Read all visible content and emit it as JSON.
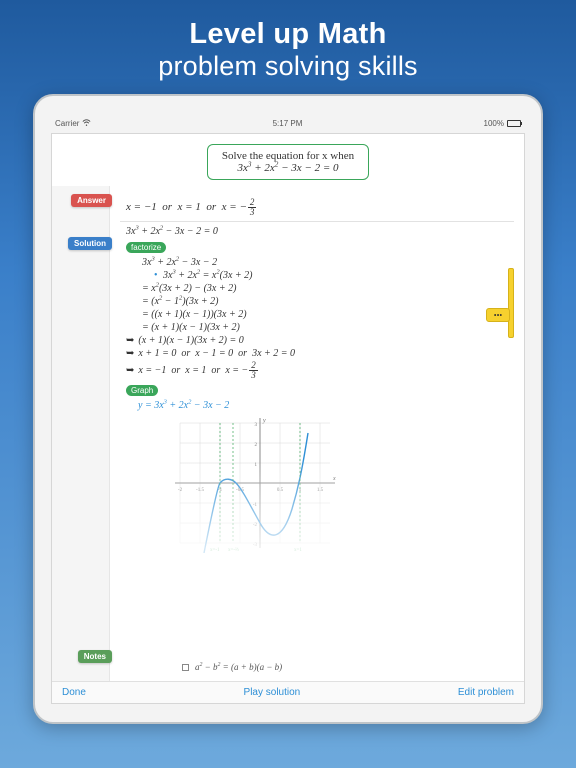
{
  "hero": {
    "title": "Level up Math",
    "subtitle": "problem solving skills"
  },
  "statusbar": {
    "carrier": "Carrier",
    "time": "5:17 PM",
    "battery": "100%"
  },
  "problem": {
    "prompt": "Solve the equation for x when",
    "equation_html": "3<i>x</i><sup>3</sup> + 2<i>x</i><sup>2</sup> − 3<i>x</i> − 2 = 0"
  },
  "badges": {
    "answer": "Answer",
    "solution": "Solution",
    "notes": "Notes"
  },
  "answer_html": "<i>x</i> = −1 &nbsp;or&nbsp; <i>x</i> = 1 &nbsp;or&nbsp; <i>x</i> = −<span class='frac'><span class='n'>2</span><span class='d'>3</span></span>",
  "solution": {
    "start_html": "3<i>x</i><sup>3</sup> + 2<i>x</i><sup>2</sup> − 3<i>x</i> − 2 = 0",
    "factor_label": "factorize",
    "steps_html": [
      "3<i>x</i><sup>3</sup> + 2<i>x</i><sup>2</sup> − 3<i>x</i> − 2",
      "<span class='dot'>•</span> 3<i>x</i><sup>3</sup> + 2<i>x</i><sup>2</sup> = <i>x</i><sup>2</sup>(3<i>x</i> + 2)",
      "= <i>x</i><sup>2</sup>(3<i>x</i> + 2) − (3<i>x</i> + 2)",
      "= (<i>x</i><sup>2</sup> − 1<sup>2</sup>)(3<i>x</i> + 2)",
      "= ((<i>x</i> + 1)(<i>x</i> − 1))(3<i>x</i> + 2)",
      "= (<i>x</i> + 1)(<i>x</i> − 1)(3<i>x</i> + 2)"
    ],
    "implications_html": [
      "(<i>x</i> + 1)(<i>x</i> − 1)(3<i>x</i> + 2) = 0",
      "<i>x</i> + 1 = 0 &nbsp;or&nbsp; <i>x</i> − 1 = 0 &nbsp;or&nbsp; 3<i>x</i> + 2 = 0",
      "<i>x</i> = −1 &nbsp;or&nbsp; <i>x</i> = 1 &nbsp;or&nbsp; <i>x</i> = −<span class='frac'><span class='n'>2</span><span class='d'>3</span></span>"
    ],
    "graph_label": "Graph",
    "graph_function_html": "<i>y</i> = 3<i>x</i><sup>3</sup> + 2<i>x</i><sup>2</sup> − 3<i>x</i> − 2"
  },
  "notes_identity_html": "<i>a</i><sup>2</sup> − <i>b</i><sup>2</sup> = (<i>a</i> + <i>b</i>)(<i>a</i> − <i>b</i>)",
  "toolbar": {
    "done": "Done",
    "play": "Play solution",
    "edit": "Edit problem"
  },
  "hint_dots": "•••",
  "chart_data": {
    "type": "line",
    "title": "",
    "xlabel": "x",
    "ylabel": "y",
    "xlim": [
      -2,
      2
    ],
    "ylim": [
      -3,
      3
    ],
    "xticks": [
      -2,
      -1.5,
      -1,
      -0.5,
      0.5,
      1,
      1.5,
      2
    ],
    "yticks": [
      -3,
      -2,
      -1,
      1,
      2,
      3
    ],
    "roots_annotations": [
      "x = -1",
      "x = -2/3",
      "x = 1"
    ],
    "series": [
      {
        "name": "y = 3x^3 + 2x^2 - 3x - 2",
        "x": [
          -1.4,
          -1.2,
          -1.0,
          -0.8,
          -0.667,
          -0.5,
          -0.3,
          0.0,
          0.3,
          0.5,
          0.8,
          1.0,
          1.2
        ],
        "y": [
          -2.09,
          -0.7,
          0.0,
          0.15,
          0.0,
          -0.375,
          -0.999,
          -2.0,
          -2.64,
          -2.625,
          -1.584,
          0.0,
          2.46
        ]
      }
    ]
  }
}
